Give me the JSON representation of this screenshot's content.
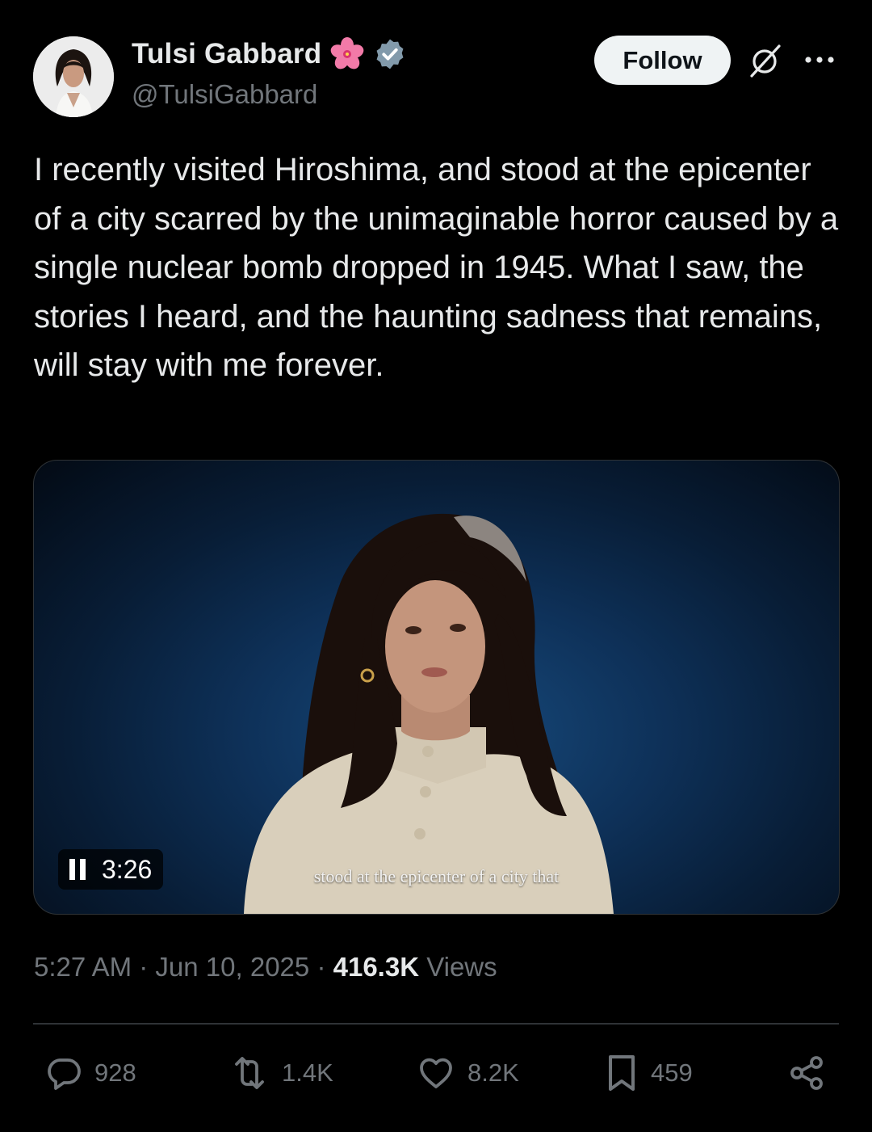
{
  "author": {
    "display_name": "Tulsi Gabbard",
    "handle": "@TulsiGabbard",
    "verified": true,
    "name_emoji": "hibiscus-icon"
  },
  "header": {
    "follow_label": "Follow"
  },
  "tweet": {
    "text": "I recently visited Hiroshima, and stood at the epicenter of a city scarred by the unimaginable horror caused by a single nuclear bomb dropped in 1945. What I saw, the stories I heard, and the haunting sadness that remains, will stay with me forever."
  },
  "media": {
    "duration": "3:26",
    "caption": "stood at the epicenter of a city that"
  },
  "meta": {
    "time": "5:27 AM",
    "date": "Jun 10, 2025",
    "separator": "·",
    "views_count": "416.3K",
    "views_label": "Views"
  },
  "actions": {
    "replies": "928",
    "reposts": "1.4K",
    "likes": "8.2K",
    "bookmarks": "459"
  },
  "colors": {
    "background": "#000000",
    "text_primary": "#e7e9ea",
    "text_secondary": "#71767b",
    "verified_badge": "#829aab",
    "divider": "#2f3336",
    "follow_button_bg": "#eff3f4"
  }
}
